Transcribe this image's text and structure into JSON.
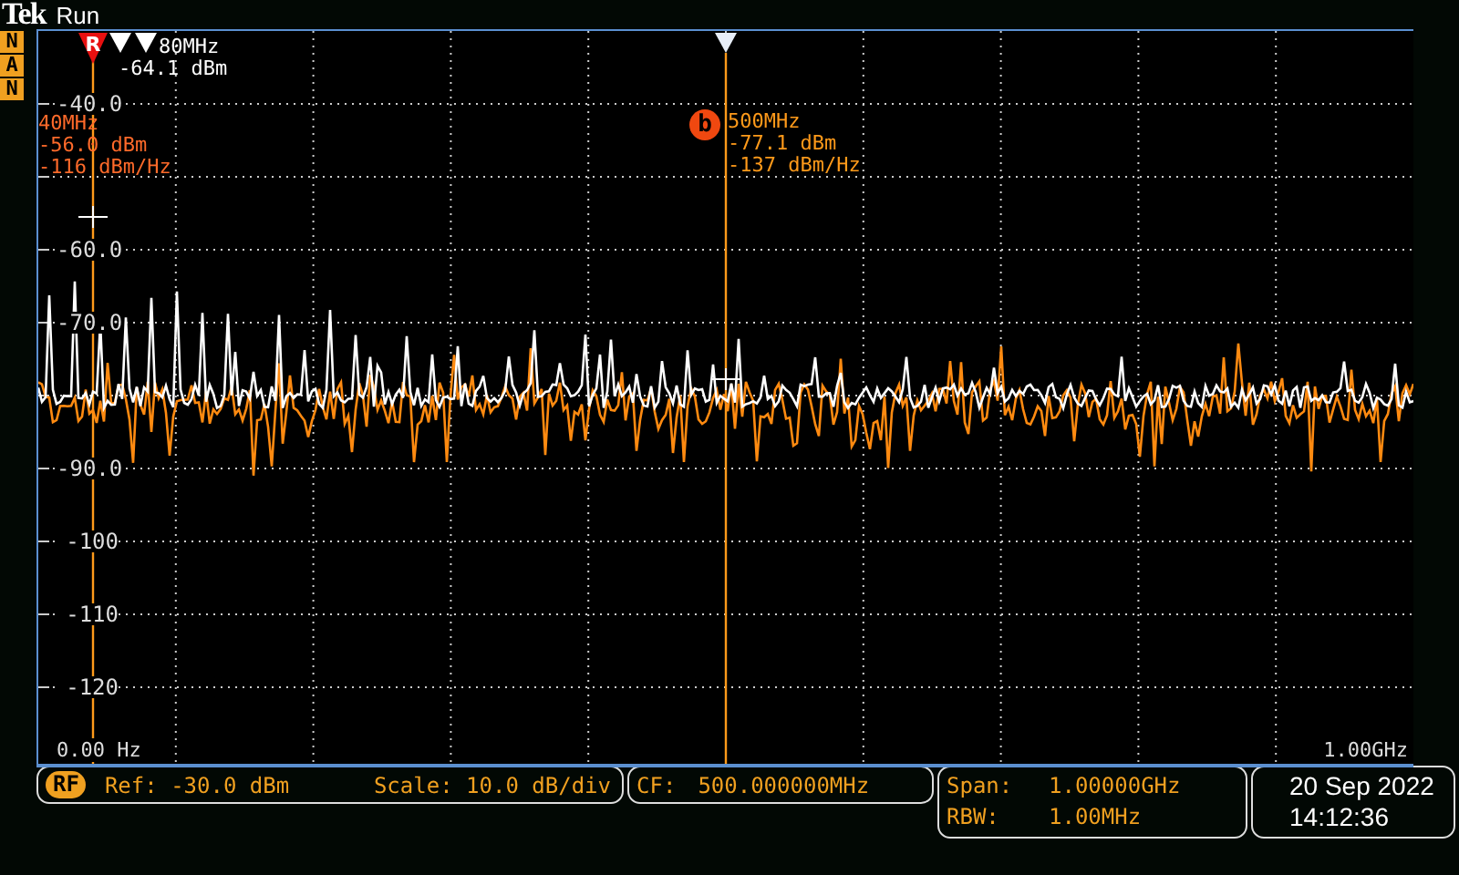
{
  "header": {
    "brand": "Tek",
    "state": "Run"
  },
  "side_badges": [
    "N",
    "A",
    "N"
  ],
  "reference_marker": {
    "label": "R"
  },
  "readouts": [
    {
      "kind": "marker",
      "lines": [
        "80MHz",
        "-64.1 dBm"
      ]
    },
    {
      "kind": "cursor",
      "lines": [
        "40MHz",
        "-56.0 dBm",
        "-116 dBm/Hz"
      ]
    },
    {
      "kind": "cursor",
      "badge": "b",
      "lines": [
        "500MHz",
        "-77.1 dBm",
        "-137 dBm/Hz"
      ]
    }
  ],
  "y_labels": [
    "-40.0",
    "-60.0",
    "-70.0",
    "-90.0",
    "-100",
    "-110",
    "-120"
  ],
  "x_labels": {
    "start": "0.00 Hz",
    "end": "1.00GHz"
  },
  "status": {
    "rf_badge": "RF",
    "ref": "Ref: -30.0 dBm",
    "scale": "Scale: 10.0 dB/div",
    "cf_label": "CF:",
    "cf_value": "500.000000MHz",
    "span_label": "Span:",
    "span_value": "1.00000GHz",
    "rbw_label": "RBW:",
    "rbw_value": "1.00MHz",
    "date": "20 Sep 2022",
    "time": "14:12:36"
  }
}
